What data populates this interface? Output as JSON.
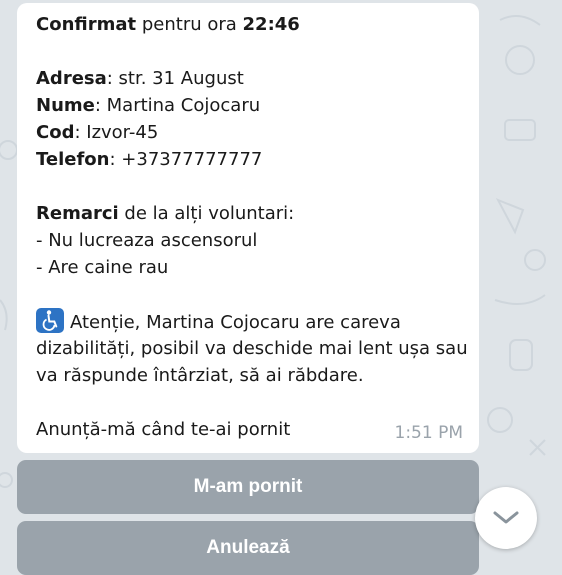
{
  "message": {
    "confirm_word": "Confirmat",
    "confirm_rest": " pentru ora ",
    "confirm_time": "22:46",
    "address_label": "Adresa",
    "address_value": ": str. 31 August",
    "name_label": "Nume",
    "name_value": ": Martina Cojocaru",
    "code_label": "Cod",
    "code_value": ": Izvor-45",
    "phone_label": "Telefon",
    "phone_value": ": +37377777777",
    "remarks_label": "Remarci",
    "remarks_rest": " de la alți voluntari:",
    "remark_1": "- Nu lucreaza ascensorul",
    "remark_2": "- Are caine rau",
    "attention_line1": "Atenție, Martina Cojocaru are careva",
    "attention_line2": "dizabilități, posibil va deschide mai lent ușa sau",
    "attention_line3": "va răspunde întârziat, să ai răbdare.",
    "notify_text": "Anunță-mă când te-ai pornit",
    "timestamp": "1:51 PM",
    "accessibility_icon": "wheelchair-icon"
  },
  "keyboard": {
    "button_started": "M-am pornit",
    "button_cancel": "Anulează"
  },
  "scroll_button": {
    "icon": "chevron-down-icon"
  },
  "colors": {
    "chat_background": "#dfe4e8",
    "bubble": "#ffffff",
    "keyboard_button": "#9aa3ab",
    "accessibility_icon_bg": "#2d73c4",
    "timestamp": "#9aa3ab"
  }
}
